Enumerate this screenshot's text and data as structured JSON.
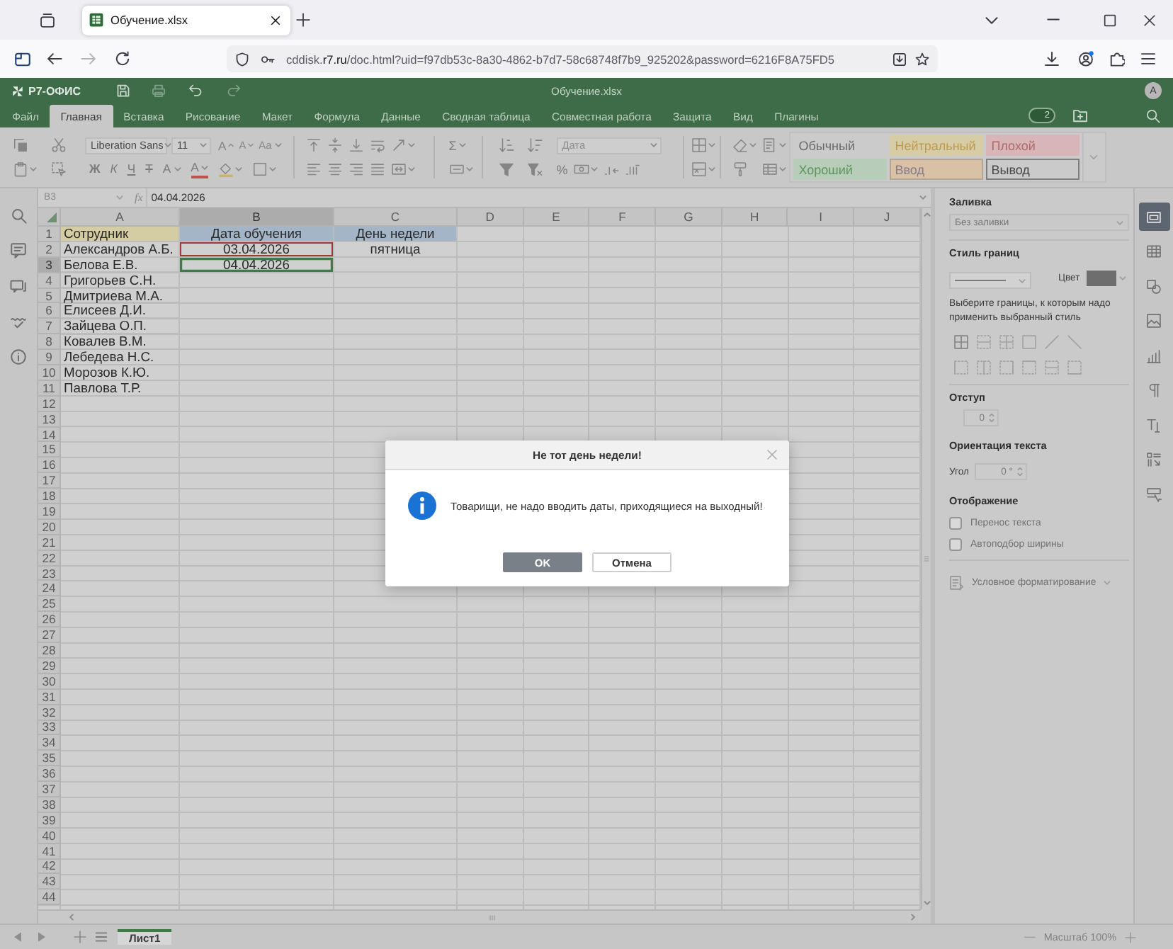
{
  "browser": {
    "tabs": [
      {
        "title": "Обучение.xlsx",
        "selected": true
      }
    ],
    "url": "cddisk.**r7.ru**/doc.html?uid=f97db53c-8a30-4862-b7d7-58c68748f7b9_925202&password=6216F8A75FD5"
  },
  "app": {
    "brand": "Р7-ОФИС",
    "document_title": "Обучение.xlsx",
    "user_initial": "A",
    "collaborators": "2"
  },
  "menu": [
    {
      "label": "Файл",
      "selected": false
    },
    {
      "label": "Главная",
      "selected": true
    },
    {
      "label": "Вставка",
      "selected": false
    },
    {
      "label": "Рисование",
      "selected": false
    },
    {
      "label": "Макет",
      "selected": false
    },
    {
      "label": "Формула",
      "selected": false
    },
    {
      "label": "Данные",
      "selected": false
    },
    {
      "label": "Сводная таблица",
      "selected": false
    },
    {
      "label": "Совместная работа",
      "selected": false
    },
    {
      "label": "Защита",
      "selected": false
    },
    {
      "label": "Вид",
      "selected": false
    },
    {
      "label": "Плагины",
      "selected": false
    }
  ],
  "toolbar": {
    "font_name": "Liberation Sans",
    "font_size": "11",
    "case_buttons": [
      "A",
      "A",
      "Aa"
    ],
    "format_buttons": [
      "Ж",
      "К",
      "Ч",
      "Т",
      "A",
      "A"
    ],
    "sum": "Σ",
    "number_format": "Дата",
    "percent": "%",
    "cell_styles": [
      {
        "label": "Обычный",
        "kind": "normal"
      },
      {
        "label": "Нейтральный",
        "kind": "neutral"
      },
      {
        "label": "Плохой",
        "kind": "bad"
      },
      {
        "label": "Хороший",
        "kind": "good"
      },
      {
        "label": "Ввод",
        "kind": "input"
      },
      {
        "label": "Вывод",
        "kind": "output"
      }
    ]
  },
  "formula_bar": {
    "cell": "B3",
    "function_label": "fx",
    "formula": "04.04.2026"
  },
  "sheet": {
    "columns": [
      {
        "label": "A",
        "selected": false
      },
      {
        "label": "B",
        "selected": true
      },
      {
        "label": "C",
        "selected": false
      },
      {
        "label": "D",
        "selected": false
      },
      {
        "label": "E",
        "selected": false
      },
      {
        "label": "F",
        "selected": false
      },
      {
        "label": "G",
        "selected": false
      },
      {
        "label": "H",
        "selected": false
      },
      {
        "label": "I",
        "selected": false
      },
      {
        "label": "J",
        "selected": false
      }
    ],
    "rows": [
      {
        "header": "1",
        "selected": false,
        "cells": [
          {
            "text": "Сотрудник",
            "color": "#d4cca2",
            "selected": false,
            "outlined": false
          },
          {
            "text": "Дата обучения",
            "color": "#a4b5c7",
            "selected": false,
            "outlined": false
          },
          {
            "text": "День недели",
            "color": "#a4b5c7",
            "selected": false,
            "outlined": false
          }
        ]
      },
      {
        "header": "2",
        "selected": false,
        "cells": [
          {
            "text": "Александров А.Б.",
            "selected": false,
            "outlined": false
          },
          {
            "text": "03.04.2026",
            "selected": false,
            "outlined": true
          },
          {
            "text": "пятница",
            "selected": false,
            "outlined": false
          }
        ]
      },
      {
        "header": "3",
        "selected": true,
        "cells": [
          {
            "text": "Белова Е.В.",
            "selected": false,
            "outlined": false
          },
          {
            "text": "04.04.2026",
            "selected": true,
            "outlined": false
          }
        ]
      },
      {
        "header": "4",
        "selected": false,
        "cells": [
          {
            "text": "Григорьев С.Н.",
            "selected": false,
            "outlined": false
          }
        ]
      },
      {
        "header": "5",
        "selected": false,
        "cells": [
          {
            "text": "Дмитриева М.А.",
            "selected": false,
            "outlined": false
          }
        ]
      },
      {
        "header": "6",
        "selected": false,
        "cells": [
          {
            "text": "Елисеев Д.И.",
            "selected": false,
            "outlined": false
          }
        ]
      },
      {
        "header": "7",
        "selected": false,
        "cells": [
          {
            "text": "Зайцева О.П.",
            "selected": false,
            "outlined": false
          }
        ]
      },
      {
        "header": "8",
        "selected": false,
        "cells": [
          {
            "text": "Ковалев В.М.",
            "selected": false,
            "outlined": false
          }
        ]
      },
      {
        "header": "9",
        "selected": false,
        "cells": [
          {
            "text": "Лебедева Н.С.",
            "selected": false,
            "outlined": false
          }
        ]
      },
      {
        "header": "10",
        "selected": false,
        "cells": [
          {
            "text": "Морозов К.Ю.",
            "selected": false,
            "outlined": false
          }
        ]
      },
      {
        "header": "11",
        "selected": false,
        "cells": [
          {
            "text": "Павлова Т.Р.",
            "selected": false,
            "outlined": false
          }
        ]
      },
      {
        "header": "12",
        "selected": false
      },
      {
        "header": "13",
        "selected": false
      },
      {
        "header": "14",
        "selected": false
      },
      {
        "header": "15",
        "selected": false
      },
      {
        "header": "16",
        "selected": false
      },
      {
        "header": "17",
        "selected": false
      },
      {
        "header": "18",
        "selected": false
      },
      {
        "header": "19",
        "selected": false
      },
      {
        "header": "20",
        "selected": false
      },
      {
        "header": "21",
        "selected": false
      },
      {
        "header": "22",
        "selected": false
      },
      {
        "header": "23",
        "selected": false
      },
      {
        "header": "24",
        "selected": false
      },
      {
        "header": "25",
        "selected": false
      },
      {
        "header": "26",
        "selected": false
      },
      {
        "header": "27",
        "selected": false
      },
      {
        "header": "28",
        "selected": false
      },
      {
        "header": "29",
        "selected": false
      },
      {
        "header": "30",
        "selected": false
      },
      {
        "header": "31",
        "selected": false
      },
      {
        "header": "32",
        "selected": false
      },
      {
        "header": "33",
        "selected": false
      },
      {
        "header": "34",
        "selected": false
      },
      {
        "header": "35",
        "selected": false
      },
      {
        "header": "36",
        "selected": false
      },
      {
        "header": "37",
        "selected": false
      },
      {
        "header": "38",
        "selected": false
      },
      {
        "header": "39",
        "selected": false
      },
      {
        "header": "40",
        "selected": false
      },
      {
        "header": "41",
        "selected": false
      },
      {
        "header": "42",
        "selected": false
      },
      {
        "header": "43",
        "selected": false
      },
      {
        "header": "44",
        "selected": false
      }
    ]
  },
  "right_panel": {
    "fill": {
      "title": "Заливка",
      "value": "Без заливки",
      "disabled": true
    },
    "border_style": {
      "title": "Стиль границ",
      "color_label": "Цвет",
      "color": "#6e6e6e",
      "hint": "Выберите границы, к которым надо применить выбранный стиль"
    },
    "indent": {
      "title": "Отступ",
      "value": "0"
    },
    "orientation": {
      "title": "Ориентация текста",
      "angle_label": "Угол",
      "angle": "0 °"
    },
    "display": {
      "title": "Отображение",
      "options": [
        {
          "label": "Перенос текста",
          "checked": false,
          "disabled": true
        },
        {
          "label": "Автоподбор ширины",
          "checked": false,
          "disabled": true
        }
      ]
    },
    "conditional_formatting": {
      "label": "Условное форматирование",
      "disabled": true
    }
  },
  "side_tabs": [
    {
      "selected": true
    },
    {
      "selected": false
    },
    {
      "selected": false
    },
    {
      "selected": false
    },
    {
      "selected": false
    },
    {
      "selected": false
    },
    {
      "selected": false
    },
    {
      "selected": false
    },
    {
      "selected": false
    }
  ],
  "status_bar": {
    "sheet_tabs": [
      {
        "label": "Лист1",
        "selected": true
      }
    ],
    "zoom": "Масштаб 100%"
  },
  "dialog": {
    "title": "Не тот день недели!",
    "message": "Товарищи, не надо вводить даты, приходящиеся на выходный!",
    "buttons": [
      {
        "label": "OK",
        "kind": "primary"
      },
      {
        "label": "Отмена",
        "kind": "secondary"
      }
    ]
  }
}
